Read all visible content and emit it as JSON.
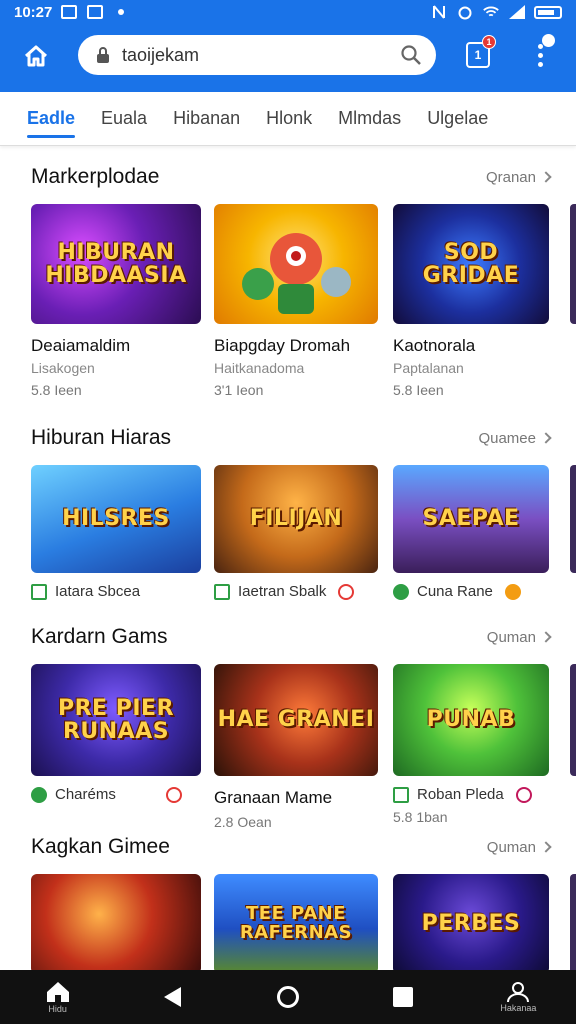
{
  "status": {
    "time": "10:27"
  },
  "search": {
    "value": "taoijekam"
  },
  "tab_count": {
    "count": "1",
    "badge": "1"
  },
  "menu_badge": "1",
  "tabs": [
    {
      "label": "Eadle",
      "active": true
    },
    {
      "label": "Euala"
    },
    {
      "label": "Hibanan"
    },
    {
      "label": "Hlonk"
    },
    {
      "label": "Mlmdas"
    },
    {
      "label": "Ulgelae"
    }
  ],
  "sections": [
    {
      "title": "Markerplodae",
      "more": "Qranan",
      "cards": [
        {
          "art": "HIBURAN HIBDAASIA",
          "name": "Deaiamaldim",
          "sub": "Lisakogen",
          "meta": "5.8 Ieen"
        },
        {
          "art": "",
          "name": "Biapgday Dromah",
          "sub": "Haitkanadoma",
          "meta": "3'1 Ieon"
        },
        {
          "art": "SOD GRIDAE",
          "name": "Kaotnorala",
          "sub": "Paptalanan",
          "meta": "5.8 Ieen"
        }
      ]
    },
    {
      "title": "Hiburan Hiaras",
      "more": "Quamee",
      "cards": [
        {
          "art": "HILSRES",
          "tag": "Iatara Sbcea"
        },
        {
          "art": "FILIJAN",
          "tag": "Iaetran Sbalk"
        },
        {
          "art": "SAEPAE",
          "tag": "Cuna Rane"
        }
      ]
    },
    {
      "title": "Kardarn Gams",
      "more": "Quman",
      "cards": [
        {
          "art": "PRE PIER RUNAAS",
          "tag": "Charéms"
        },
        {
          "art": "HAE GRANEI",
          "name": "Granaan Mame",
          "meta": "2.8 Oean"
        },
        {
          "art": "PUNAB",
          "tag": "Roban Pleda",
          "meta": "5.8 1ban"
        }
      ]
    },
    {
      "title": "Kagkan Gimee",
      "more": "Quman",
      "cards": [
        {
          "art": ""
        },
        {
          "art": "TEE PANE RAFERNAS"
        },
        {
          "art": "PERBES"
        }
      ]
    }
  ],
  "navbar": {
    "account_label": "Hakanaa",
    "home_label": "Hidu"
  },
  "colors": {
    "accent": "#1a73e8",
    "badge": "#e53935",
    "nav_bg": "#111111"
  }
}
